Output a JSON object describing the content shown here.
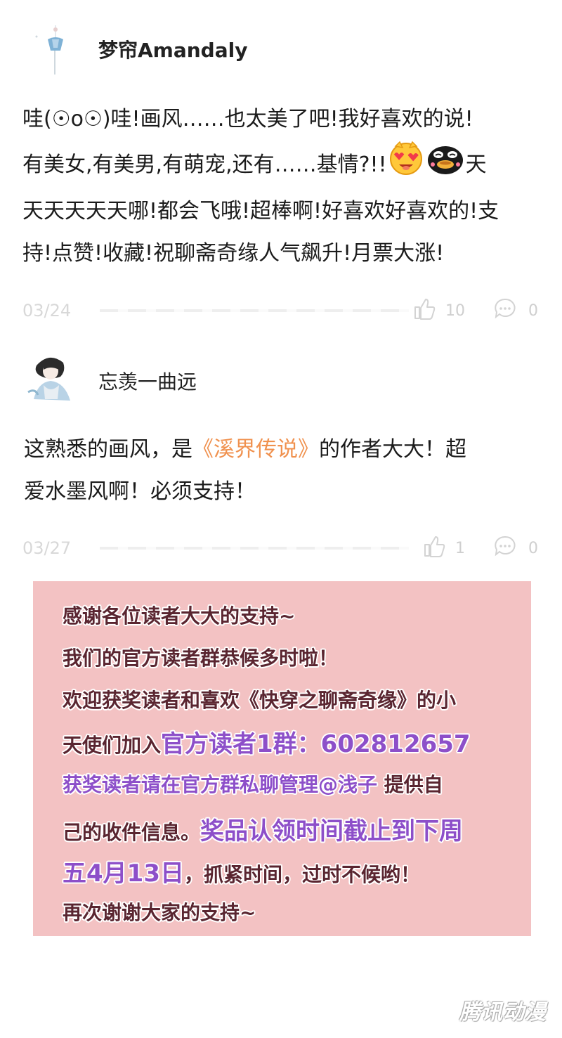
{
  "comments": [
    {
      "username": "梦帘Amandaly",
      "body_line1": "哇(☉o☉)哇!画风……也太美了吧!我好喜欢的说!",
      "body_line2_text": "有美女,有美男,有萌宠,还有……基情?!!",
      "body_line2_end": "天",
      "body_line3": "天天天天天哪!都会飞哦!超棒啊!好喜欢好喜欢的!支",
      "body_line4": "持!点赞!收藏!祝聊斋奇缘人气飙升!月票大涨!",
      "date": "03/24",
      "likes": "10",
      "replies": "0",
      "emojis": [
        "heart-eyes-emoji",
        "black-blob-emoji"
      ]
    },
    {
      "username": "忘羡一曲远",
      "body_line1_pre": "这熟悉的画风，是",
      "body_line1_highlight": "《溪界传说》",
      "body_line1_post": "的作者大大！超",
      "body_line2": "爱水墨风啊！必须支持！",
      "date": "03/27",
      "likes": "1",
      "replies": "0"
    }
  ],
  "notice": {
    "line1": "感谢各位读者大大的支持~",
    "line2": "我们的官方读者群恭候多时啦！",
    "line3": "欢迎获奖读者和喜欢《快穿之聊斋奇缘》的小",
    "line4_pre": "天使们加入",
    "line4_purple": "官方读者1群：602812657",
    "line5_purple": "获奖读者请在官方群私聊管理@浅子",
    "line5_post": "提供自",
    "line6_pre": "己的收件信息。",
    "line6_purple": "奖品认领时间截止到下周",
    "line7_purple": "五4月13日",
    "line7_post": "，抓紧时间，过时不候哟！",
    "line8": "再次谢谢大家的支持~"
  },
  "watermark": "腾讯动漫",
  "colors": {
    "notice_bg": "#f3c2c3",
    "highlight_orange": "#f0914e",
    "notice_purple": "#8d4fc9"
  }
}
